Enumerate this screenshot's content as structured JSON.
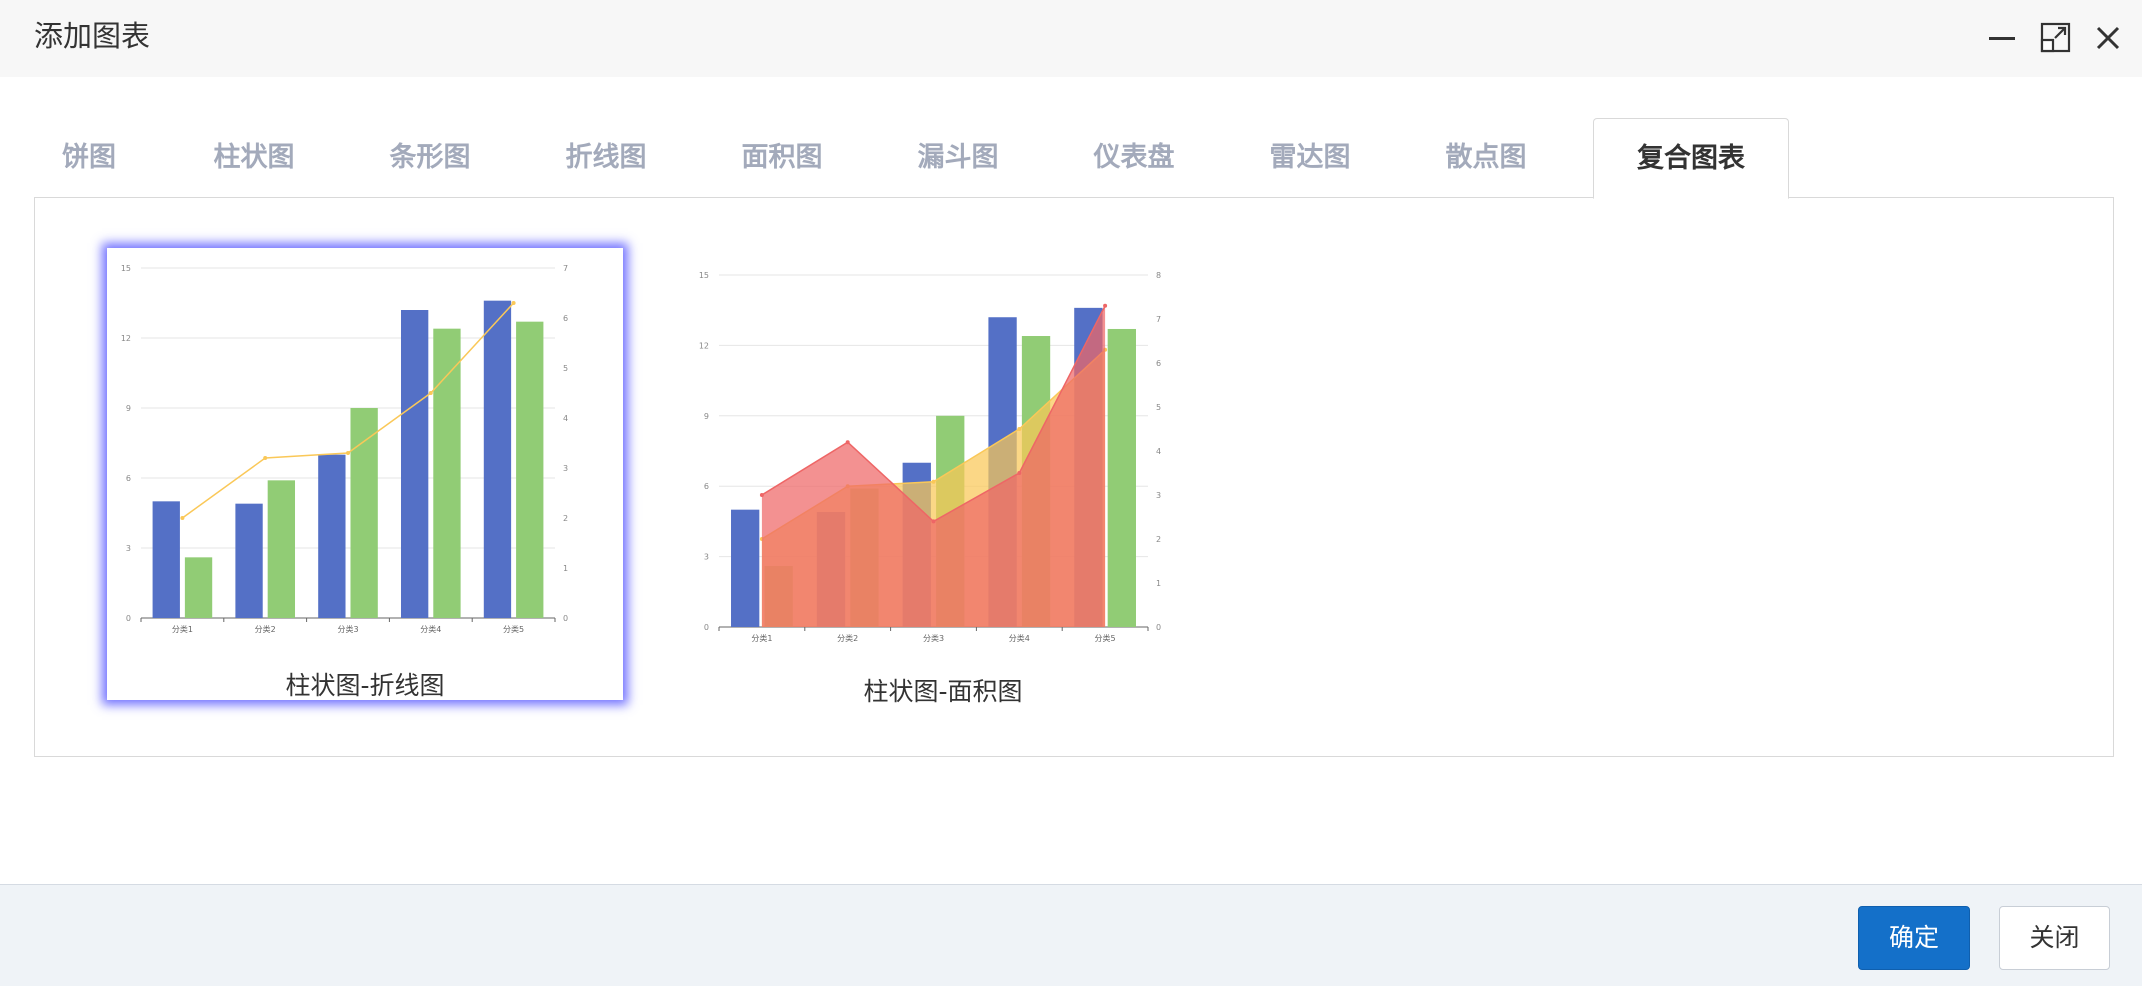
{
  "dialog": {
    "title": "添加图表"
  },
  "window_controls": {
    "minimize_icon": "minimize-icon",
    "maximize_icon": "maximize-icon",
    "close_icon": "close-icon"
  },
  "tabs": [
    {
      "label": "饼图",
      "active": false
    },
    {
      "label": "柱状图",
      "active": false
    },
    {
      "label": "条形图",
      "active": false
    },
    {
      "label": "折线图",
      "active": false
    },
    {
      "label": "面积图",
      "active": false
    },
    {
      "label": "漏斗图",
      "active": false
    },
    {
      "label": "仪表盘",
      "active": false
    },
    {
      "label": "雷达图",
      "active": false
    },
    {
      "label": "散点图",
      "active": false
    },
    {
      "label": "复合图表",
      "active": true
    }
  ],
  "cards": [
    {
      "label": "柱状图-折线图",
      "selected": true
    },
    {
      "label": "柱状图-面积图",
      "selected": false
    }
  ],
  "chart_data": [
    {
      "type": "bar",
      "categories": [
        "分类1",
        "分类2",
        "分类3",
        "分类4",
        "分类5"
      ],
      "left_axis": {
        "ticks": [
          "0",
          "3",
          "6",
          "9",
          "12",
          "15"
        ],
        "range": [
          0,
          15
        ]
      },
      "right_axis": {
        "ticks": [
          "0",
          "1",
          "2",
          "3",
          "4",
          "5",
          "6",
          "7"
        ],
        "range": [
          0,
          7
        ]
      },
      "series": [
        {
          "type": "bar",
          "axis": "left",
          "color": "#5470c6",
          "values": [
            5.0,
            4.9,
            7.0,
            13.2,
            13.6
          ]
        },
        {
          "type": "bar",
          "axis": "left",
          "color": "#91cc75",
          "values": [
            2.6,
            5.9,
            9.0,
            12.4,
            12.7
          ]
        },
        {
          "type": "line",
          "axis": "right",
          "color": "#fac858",
          "values": [
            2.0,
            3.2,
            3.3,
            4.5,
            6.3
          ]
        }
      ]
    },
    {
      "type": "bar",
      "categories": [
        "分类1",
        "分类2",
        "分类3",
        "分类4",
        "分类5"
      ],
      "left_axis": {
        "ticks": [
          "0",
          "3",
          "6",
          "9",
          "12",
          "15"
        ],
        "range": [
          0,
          15
        ]
      },
      "right_axis": {
        "ticks": [
          "0",
          "1",
          "2",
          "3",
          "4",
          "5",
          "6",
          "7",
          "8"
        ],
        "range": [
          0,
          8
        ]
      },
      "series": [
        {
          "type": "bar",
          "axis": "left",
          "color": "#5470c6",
          "values": [
            5.0,
            4.9,
            7.0,
            13.2,
            13.6
          ]
        },
        {
          "type": "bar",
          "axis": "left",
          "color": "#91cc75",
          "values": [
            2.6,
            5.9,
            9.0,
            12.4,
            12.7
          ]
        },
        {
          "type": "area",
          "axis": "right",
          "color": "#fac858",
          "values": [
            2.0,
            3.2,
            3.3,
            4.5,
            6.3
          ]
        },
        {
          "type": "area",
          "axis": "right",
          "color": "#ee6666",
          "values": [
            3.0,
            4.2,
            2.4,
            3.5,
            7.3
          ]
        }
      ]
    }
  ],
  "footer": {
    "ok_label": "确定",
    "cancel_label": "关闭"
  }
}
